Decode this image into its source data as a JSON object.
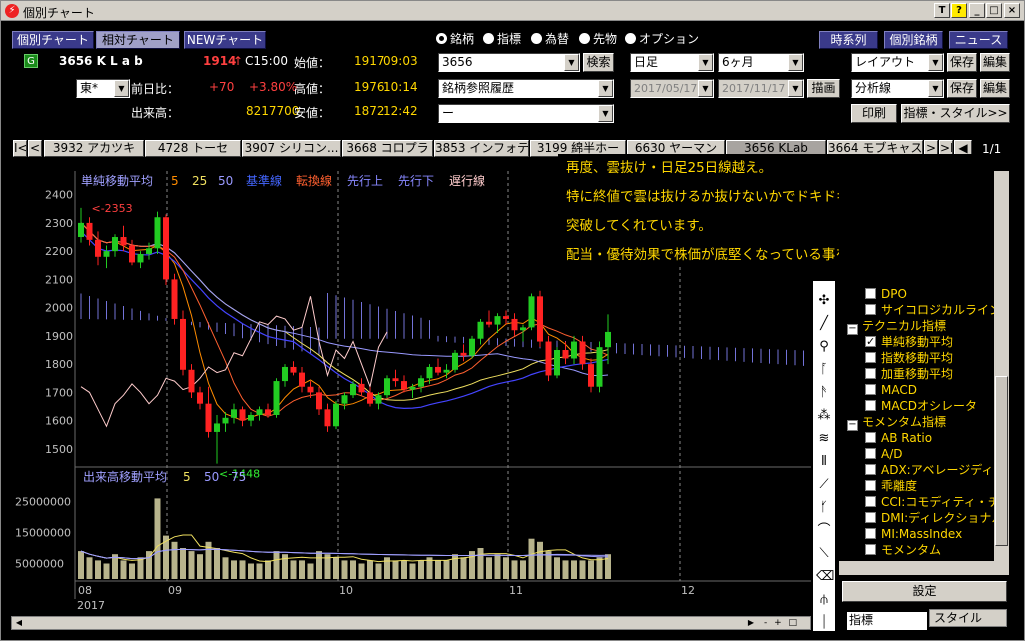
{
  "window": {
    "title": "個別チャート",
    "icon": "lightning-app-icon",
    "buttons": [
      "T",
      "?",
      "_",
      "□",
      "×"
    ]
  },
  "nav_buttons": {
    "single": "個別チャート",
    "relative": "相対チャート",
    "new": "NEWチャート"
  },
  "stock": {
    "badge": "G",
    "code_name": "3656 K L a b",
    "price": "1914",
    "arrow": "↑",
    "close_time": "C15:00",
    "open_label": "始値：",
    "open": "1917",
    "open_time": "09:03",
    "market": "東*",
    "change_label": "前日比：",
    "change": "+70",
    "change_pct": "+3.80%",
    "high_label": "高値：",
    "high": "1976",
    "high_time": "10:14",
    "volume_label": "出来高：",
    "volume": "8217700",
    "low_label": "安値：",
    "low": "1872",
    "low_time": "12:42"
  },
  "radios": [
    {
      "label": "銘柄",
      "selected": true
    },
    {
      "label": "指標",
      "selected": false
    },
    {
      "label": "為替",
      "selected": false
    },
    {
      "label": "先物",
      "selected": false
    },
    {
      "label": "オプション",
      "selected": false
    }
  ],
  "search": {
    "code": "3656",
    "search_button": "検索",
    "history": "銘柄参照履歴",
    "sub": "ー"
  },
  "period": {
    "interval": "日足",
    "range": "6ヶ月",
    "from": "2017/05/17",
    "to": "2017/11/17",
    "draw_button": "描画"
  },
  "right_buttons": {
    "timeseries": "時系列",
    "individual": "個別銘柄",
    "news": "ニュース",
    "layout": "レイアウト",
    "save": "保存",
    "edit": "編集",
    "analysis": "分析線",
    "print": "印刷",
    "indicator_style": "指標・スタイル>>"
  },
  "tabs": {
    "items": [
      "3932 アカツキ",
      "4728 トーセ",
      "3907 シリコン...",
      "3668 コロプラ",
      "3853 インフォテリ",
      "3199 綿半ホー",
      "6630 ヤーマン",
      "3656 KLab",
      "3664 モブキャス"
    ],
    "selected": 7,
    "page": "1/1"
  },
  "memo": {
    "lines": [
      "再度、雲抜け・日足25日線越え。",
      "特に終値で雲は抜けるか抜けないかでドキドキでしたが無事",
      "突破してくれています。",
      "配当・優待効果で株価が底堅くなっている事を祈ります。"
    ]
  },
  "price_legend": {
    "title": "単純移動平均",
    "p5": "5",
    "p25": "25",
    "p50": "50",
    "kijun": "基準線",
    "tenkan": "転換線",
    "senkou_a": "先行上",
    "senkou_b": "先行下",
    "chikou": "遅行線"
  },
  "volume_legend": {
    "title": "出来高移動平均",
    "p5": "5",
    "p50": "50",
    "p75": "75"
  },
  "colors": {
    "up": "#22cc22",
    "down": "#ff2222",
    "ma5": "#ff8c00",
    "ma25": "#f0e060",
    "ma50": "#9999ff",
    "kijun": "#4444ff",
    "tenkan": "#ff6030",
    "cloud": "#8888ff",
    "chikou": "#ffcccc",
    "volume": "#b8b48c"
  },
  "chart_data": {
    "type": "candlestick",
    "y_ticks": [
      1500,
      1600,
      1700,
      1800,
      1900,
      2000,
      2100,
      2200,
      2300,
      2400
    ],
    "volume_ticks": [
      "25000000",
      "15000000",
      "5000000"
    ],
    "x_month_labels": [
      "08",
      "09",
      "10",
      "11",
      "12"
    ],
    "year_label": "2017",
    "annotations": [
      {
        "text": "<-2353"
      },
      {
        "text": "<-1448"
      }
    ],
    "candles": [
      [
        2250,
        2353,
        2230,
        2300
      ],
      [
        2300,
        2320,
        2220,
        2240
      ],
      [
        2240,
        2270,
        2150,
        2180
      ],
      [
        2180,
        2220,
        2140,
        2200
      ],
      [
        2200,
        2260,
        2180,
        2250
      ],
      [
        2250,
        2290,
        2200,
        2220
      ],
      [
        2220,
        2240,
        2150,
        2160
      ],
      [
        2160,
        2200,
        2140,
        2190
      ],
      [
        2190,
        2230,
        2170,
        2210
      ],
      [
        2210,
        2340,
        2190,
        2320
      ],
      [
        2320,
        2330,
        2080,
        2100
      ],
      [
        2100,
        2120,
        1940,
        1960
      ],
      [
        1960,
        1990,
        1760,
        1780
      ],
      [
        1780,
        1800,
        1680,
        1700
      ],
      [
        1700,
        1720,
        1640,
        1660
      ],
      [
        1660,
        1720,
        1540,
        1560
      ],
      [
        1560,
        1620,
        1448,
        1590
      ],
      [
        1590,
        1630,
        1560,
        1610
      ],
      [
        1610,
        1660,
        1590,
        1640
      ],
      [
        1640,
        1650,
        1580,
        1600
      ],
      [
        1600,
        1630,
        1580,
        1620
      ],
      [
        1620,
        1650,
        1600,
        1640
      ],
      [
        1640,
        1660,
        1610,
        1620
      ],
      [
        1620,
        1750,
        1610,
        1740
      ],
      [
        1740,
        1800,
        1720,
        1790
      ],
      [
        1790,
        1810,
        1760,
        1770
      ],
      [
        1770,
        1790,
        1700,
        1720
      ],
      [
        1720,
        1740,
        1680,
        1700
      ],
      [
        1700,
        1720,
        1620,
        1640
      ],
      [
        1640,
        1660,
        1560,
        1580
      ],
      [
        1580,
        1670,
        1570,
        1660
      ],
      [
        1660,
        1700,
        1640,
        1690
      ],
      [
        1690,
        1740,
        1680,
        1730
      ],
      [
        1730,
        1750,
        1690,
        1700
      ],
      [
        1700,
        1720,
        1650,
        1660
      ],
      [
        1660,
        1700,
        1640,
        1690
      ],
      [
        1690,
        1760,
        1680,
        1750
      ],
      [
        1750,
        1780,
        1720,
        1740
      ],
      [
        1740,
        1760,
        1700,
        1710
      ],
      [
        1710,
        1730,
        1680,
        1720
      ],
      [
        1720,
        1760,
        1700,
        1750
      ],
      [
        1750,
        1800,
        1730,
        1790
      ],
      [
        1790,
        1820,
        1760,
        1770
      ],
      [
        1770,
        1800,
        1750,
        1780
      ],
      [
        1780,
        1850,
        1770,
        1840
      ],
      [
        1840,
        1870,
        1810,
        1830
      ],
      [
        1830,
        1900,
        1820,
        1890
      ],
      [
        1890,
        1960,
        1870,
        1950
      ],
      [
        1950,
        1990,
        1930,
        1940
      ],
      [
        1940,
        1980,
        1910,
        1970
      ],
      [
        1970,
        1990,
        1940,
        1960
      ],
      [
        1960,
        1980,
        1900,
        1920
      ],
      [
        1920,
        1940,
        1880,
        1930
      ],
      [
        1930,
        2050,
        1920,
        2040
      ],
      [
        2040,
        2060,
        1860,
        1880
      ],
      [
        1880,
        1900,
        1740,
        1760
      ],
      [
        1760,
        1860,
        1750,
        1850
      ],
      [
        1850,
        1880,
        1800,
        1820
      ],
      [
        1820,
        1900,
        1800,
        1880
      ],
      [
        1880,
        1900,
        1780,
        1800
      ],
      [
        1800,
        1820,
        1700,
        1720
      ],
      [
        1720,
        1880,
        1700,
        1860
      ],
      [
        1860,
        1976,
        1800,
        1914
      ]
    ],
    "volumes": [
      9,
      7,
      6,
      5,
      8,
      6,
      5,
      7,
      9,
      26,
      14,
      12,
      10,
      9,
      8,
      12,
      10,
      7,
      6,
      6,
      5,
      5,
      6,
      9,
      8,
      6,
      6,
      5,
      9,
      8,
      7,
      6,
      6,
      5,
      6,
      5,
      7,
      6,
      6,
      5,
      6,
      7,
      6,
      6,
      8,
      7,
      9,
      10,
      7,
      8,
      7,
      6,
      6,
      13,
      12,
      9,
      7,
      6,
      6,
      6,
      6,
      7,
      8
    ]
  },
  "tree": {
    "items": [
      {
        "label": "DPO",
        "type": "cb",
        "checked": false,
        "indent": 1
      },
      {
        "label": "サイコロジカルライン",
        "type": "cb",
        "checked": false,
        "indent": 1
      },
      {
        "label": "テクニカル指標",
        "type": "group",
        "indent": 0
      },
      {
        "label": "単純移動平均",
        "type": "cb",
        "checked": true,
        "indent": 1
      },
      {
        "label": "指数移動平均",
        "type": "cb",
        "checked": false,
        "indent": 1
      },
      {
        "label": "加重移動平均",
        "type": "cb",
        "checked": false,
        "indent": 1
      },
      {
        "label": "MACD",
        "type": "cb",
        "checked": false,
        "indent": 1
      },
      {
        "label": "MACDオシレータ",
        "type": "cb",
        "checked": false,
        "indent": 1
      },
      {
        "label": "モメンタム指標",
        "type": "group",
        "indent": 0
      },
      {
        "label": "AB Ratio",
        "type": "cb",
        "checked": false,
        "indent": 1
      },
      {
        "label": "A/D",
        "type": "cb",
        "checked": false,
        "indent": 1
      },
      {
        "label": "ADX:アベレージディレ",
        "type": "cb",
        "checked": false,
        "indent": 1
      },
      {
        "label": "乖離度",
        "type": "cb",
        "checked": false,
        "indent": 1
      },
      {
        "label": "CCI:コモディティ・チャ",
        "type": "cb",
        "checked": false,
        "indent": 1
      },
      {
        "label": "DMI:ディレクショナル",
        "type": "cb",
        "checked": false,
        "indent": 1
      },
      {
        "label": "MI:MassIndex",
        "type": "cb",
        "checked": false,
        "indent": 1
      },
      {
        "label": "モメンタム",
        "type": "cb",
        "checked": false,
        "indent": 1
      }
    ],
    "settings_button": "設定",
    "bottom_tabs": [
      "指標",
      "スタイル"
    ]
  },
  "tools": [
    "crosshair-icon",
    "trendline-icon",
    "fan-icon",
    "fibonacci-icon",
    "fibonacci-fan-icon",
    "arc-icon",
    "channel-icon",
    "retracement-icon",
    "parallel-line-icon",
    "gann-icon",
    "cycle-icon",
    "time-zone-icon",
    "eraser-icon",
    "pitchfork-icon",
    "delete-icon"
  ]
}
